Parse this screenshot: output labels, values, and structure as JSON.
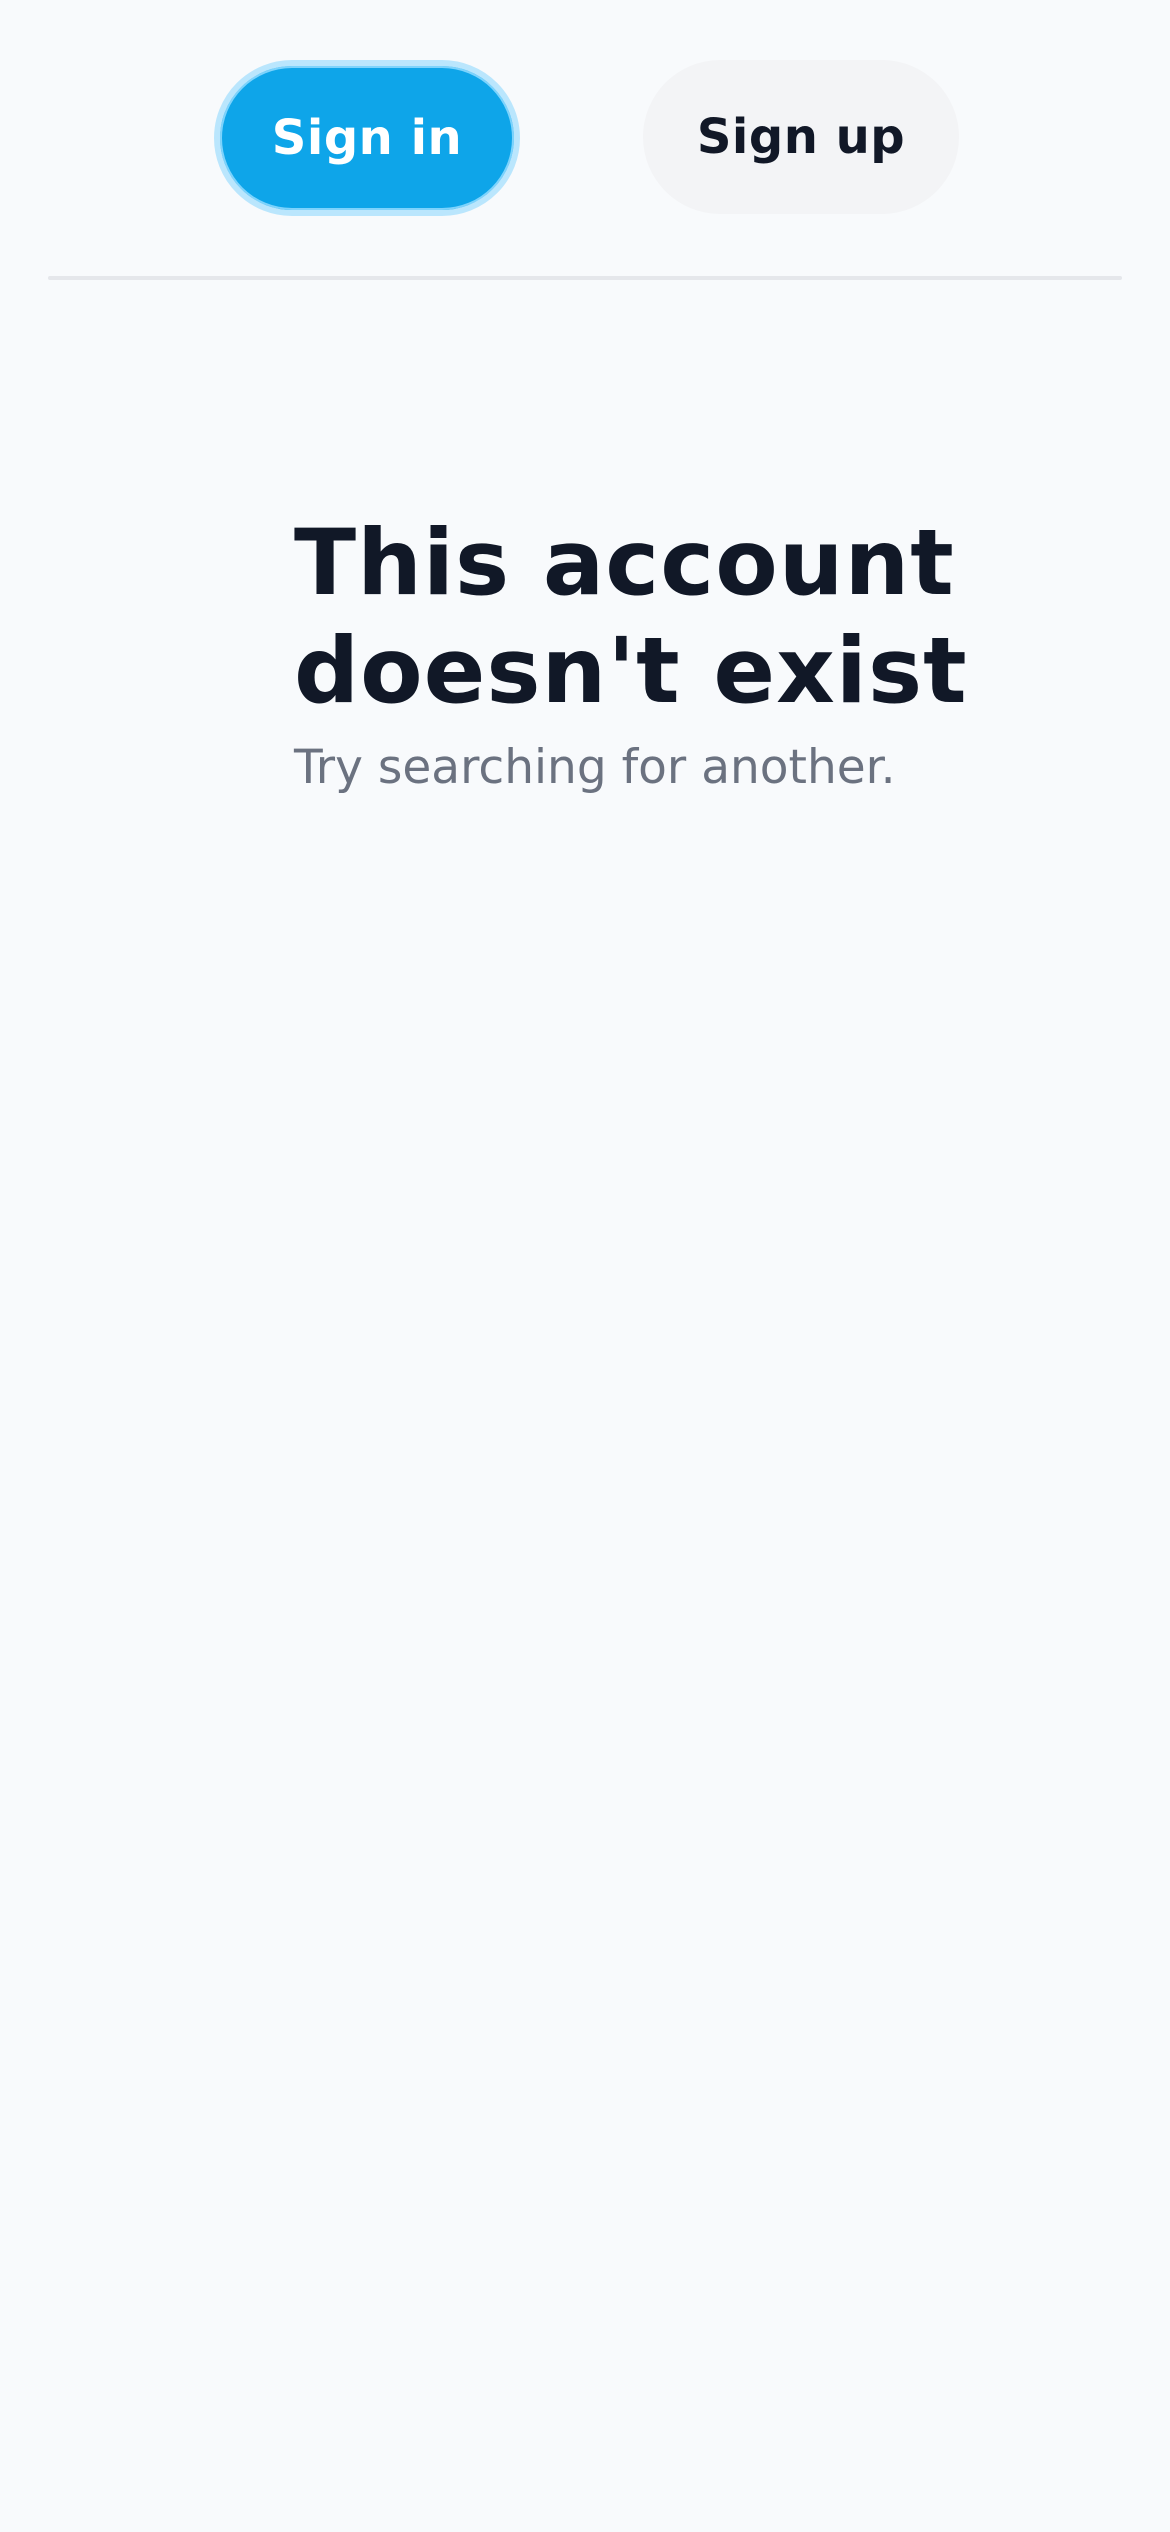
{
  "header": {
    "sign_in_label": "Sign in",
    "sign_up_label": "Sign up"
  },
  "empty_state": {
    "title": "This account doesn't exist",
    "subtitle": "Try searching for another."
  },
  "colors": {
    "primary": "#0ea5e9",
    "text_dark": "#111827",
    "text_muted": "#6b7280",
    "background": "#f8fafc"
  }
}
